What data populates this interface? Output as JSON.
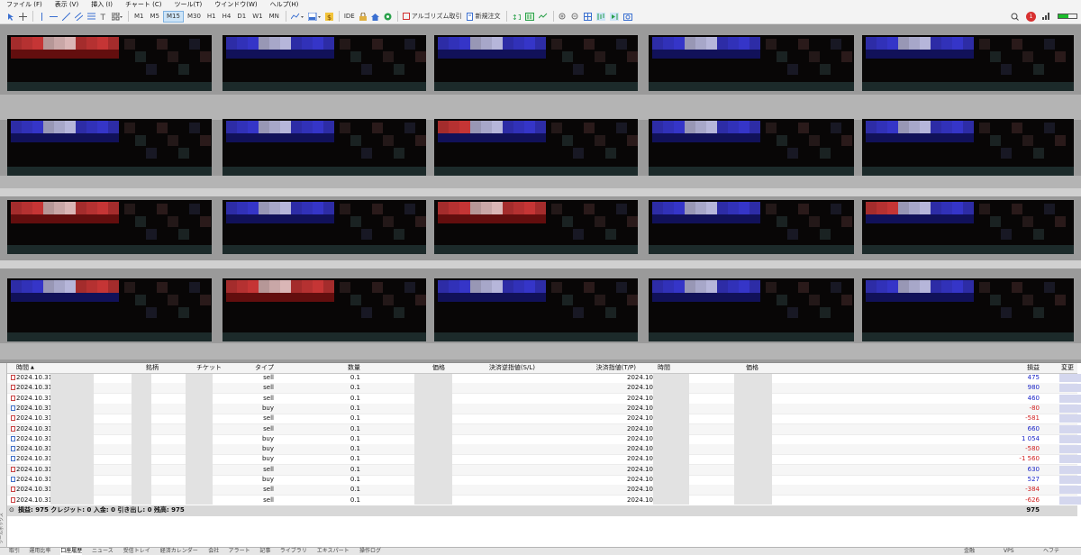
{
  "menu": [
    "ファイル (F)",
    "表示 (V)",
    "挿入 (I)",
    "チャート (C)",
    "ツール(T)",
    "ウインドウ(W)",
    "ヘルプ(H)"
  ],
  "toolbar": {
    "timeframes": [
      "M1",
      "M5",
      "M15",
      "M30",
      "H1",
      "H4",
      "D1",
      "W1",
      "MN"
    ],
    "active_timeframe": "M15",
    "ide_label": "IDE",
    "algo_label": "アルゴリズム取引",
    "new_order_label": "新規注文",
    "notification_count": "1",
    "signal_strength": 0.55
  },
  "terminal": {
    "columns": [
      "時間",
      "銘柄",
      "チケット",
      "タイプ",
      "数量",
      "価格",
      "決済逆指値(S/L)",
      "決済指値(T/P)",
      "時間",
      "価格",
      "損益",
      "変更"
    ],
    "rows": [
      {
        "time": "2024.10.31",
        "type": "sell",
        "volume": "0.1",
        "close_time": "2024.10.31",
        "profit": "475",
        "sign": "pos"
      },
      {
        "time": "2024.10.31",
        "type": "sell",
        "volume": "0.1",
        "close_time": "2024.10.31",
        "profit": "980",
        "sign": "pos"
      },
      {
        "time": "2024.10.31",
        "type": "sell",
        "volume": "0.1",
        "close_time": "2024.10.31",
        "profit": "460",
        "sign": "pos"
      },
      {
        "time": "2024.10.31",
        "type": "buy",
        "volume": "0.1",
        "close_time": "2024.10.31",
        "profit": "-80",
        "sign": "neg"
      },
      {
        "time": "2024.10.31",
        "type": "sell",
        "volume": "0.1",
        "close_time": "2024.10.31",
        "profit": "-581",
        "sign": "neg"
      },
      {
        "time": "2024.10.31",
        "type": "sell",
        "volume": "0.1",
        "close_time": "2024.10.31",
        "profit": "660",
        "sign": "pos"
      },
      {
        "time": "2024.10.31",
        "type": "buy",
        "volume": "0.1",
        "close_time": "2024.10.31",
        "profit": "1 054",
        "sign": "pos"
      },
      {
        "time": "2024.10.31",
        "type": "buy",
        "volume": "0.1",
        "close_time": "2024.10.31",
        "profit": "-580",
        "sign": "neg"
      },
      {
        "time": "2024.10.31",
        "type": "buy",
        "volume": "0.1",
        "close_time": "2024.10.31",
        "profit": "-1 560",
        "sign": "neg"
      },
      {
        "time": "2024.10.31",
        "type": "sell",
        "volume": "0.1",
        "close_time": "2024.10.31",
        "profit": "630",
        "sign": "pos"
      },
      {
        "time": "2024.10.31",
        "type": "buy",
        "volume": "0.1",
        "close_time": "2024.10.31",
        "profit": "527",
        "sign": "pos"
      },
      {
        "time": "2024.10.31",
        "type": "sell",
        "volume": "0.1",
        "close_time": "2024.10.31",
        "profit": "-384",
        "sign": "neg"
      },
      {
        "time": "2024.10.31",
        "type": "sell",
        "volume": "0.1",
        "close_time": "2024.10.31",
        "profit": "-626",
        "sign": "neg"
      }
    ],
    "summary": "損益: 975  クレジット: 0  入金: 0  引き出し: 0  残高: 975",
    "total": "975"
  },
  "tabs": [
    "取引",
    "運用比率",
    "口座履歴",
    "ニュース",
    "受信トレイ",
    "経済カレンダー",
    "会社",
    "アラート",
    "記事",
    "ライブラリ",
    "エキスパート",
    "操作ログ"
  ],
  "active_tab": "口座履歴",
  "status_right": [
    "金融",
    "VPS",
    "ヘフテ"
  ],
  "colors": {
    "red_block": "#d83a3a",
    "blue_block": "#3a3adc",
    "profit_positive": "#1a24c8",
    "profit_negative": "#d02020"
  }
}
